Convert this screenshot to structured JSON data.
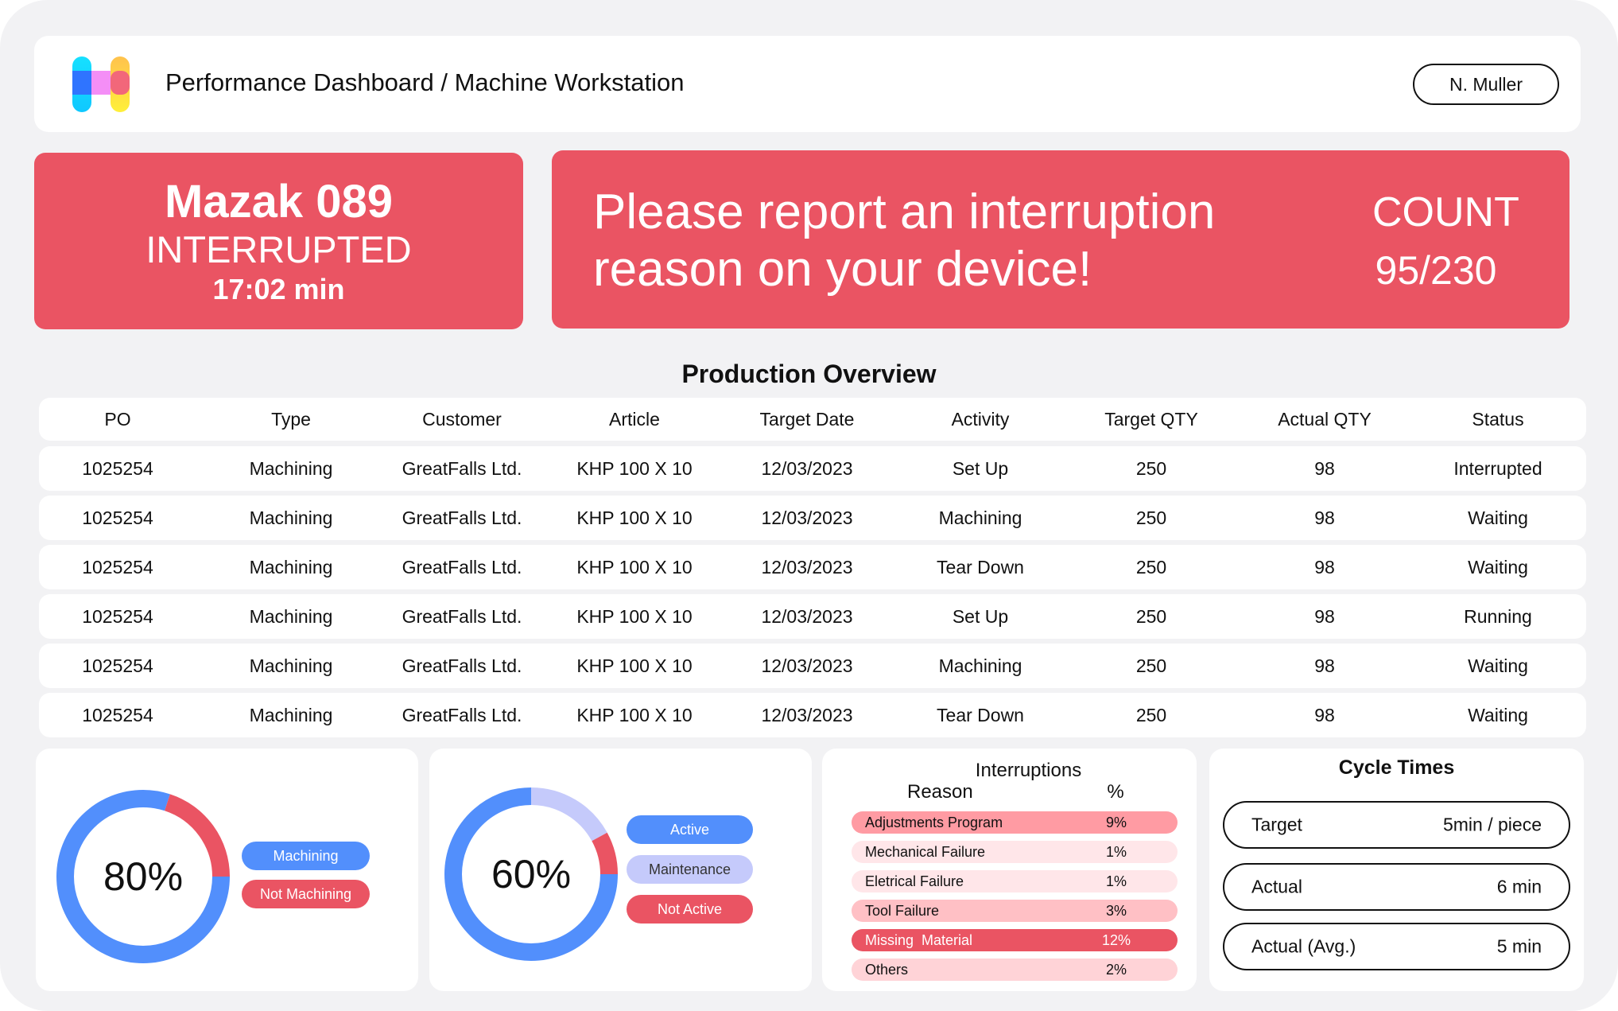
{
  "header": {
    "title": "Performance Dashboard / Machine Workstation",
    "user": "N. Muller",
    "logo": "H-logo"
  },
  "machine": {
    "name": "Mazak 089",
    "state": "INTERRUPTED",
    "duration": "17:02 min"
  },
  "alert": {
    "line1": "Please report an interruption",
    "line2": "reason on your device!",
    "count_label": "COUNT",
    "count_value": "95/230"
  },
  "production": {
    "title": "Production Overview",
    "columns": [
      "PO",
      "Type",
      "Customer",
      "Article",
      "Target Date",
      "Activity",
      "Target QTY",
      "Actual QTY",
      "Status"
    ],
    "rows": [
      [
        "1025254",
        "Machining",
        "GreatFalls Ltd.",
        "KHP 100 X 10",
        "12/03/2023",
        "Set Up",
        "250",
        "98",
        "Interrupted"
      ],
      [
        "1025254",
        "Machining",
        "GreatFalls Ltd.",
        "KHP 100 X 10",
        "12/03/2023",
        "Machining",
        "250",
        "98",
        "Waiting"
      ],
      [
        "1025254",
        "Machining",
        "GreatFalls Ltd.",
        "KHP 100 X 10",
        "12/03/2023",
        "Tear Down",
        "250",
        "98",
        "Waiting"
      ],
      [
        "1025254",
        "Machining",
        "GreatFalls Ltd.",
        "KHP 100 X 10",
        "12/03/2023",
        "Set Up",
        "250",
        "98",
        "Running"
      ],
      [
        "1025254",
        "Machining",
        "GreatFalls Ltd.",
        "KHP 100 X 10",
        "12/03/2023",
        "Machining",
        "250",
        "98",
        "Waiting"
      ],
      [
        "1025254",
        "Machining",
        "GreatFalls Ltd.",
        "KHP 100 X 10",
        "12/03/2023",
        "Tear Down",
        "250",
        "98",
        "Waiting"
      ]
    ]
  },
  "donut1": {
    "label": "80%",
    "segments": [
      {
        "name": "Machining",
        "value": 80,
        "color": "#528ffc"
      },
      {
        "name": "Not Machining",
        "value": 20,
        "color": "#ea5463"
      }
    ],
    "legend": [
      "Machining",
      "Not Machining"
    ]
  },
  "donut2": {
    "label": "60%",
    "segments": [
      {
        "name": "Active",
        "value": 75,
        "color": "#528ffc"
      },
      {
        "name": "Maintenance",
        "value": 17,
        "color": "#c5cafb"
      },
      {
        "name": "Not Active",
        "value": 8,
        "color": "#ea5463"
      }
    ],
    "legend": [
      "Active",
      "Maintenance",
      "Not Active"
    ]
  },
  "interruptions": {
    "title": "Interruptions",
    "col_reason": "Reason",
    "col_pct": "%",
    "rows": [
      {
        "reason": "Adjustments Program",
        "pct": "9%",
        "color": "#ff9ba3"
      },
      {
        "reason": "Mechanical Failure",
        "pct": "1%",
        "color": "#ffe6e9"
      },
      {
        "reason": "Eletrical Failure",
        "pct": "1%",
        "color": "#ffe6e9"
      },
      {
        "reason": "Tool Failure",
        "pct": "3%",
        "color": "#ffc0c5"
      },
      {
        "reason": "Missing  Material",
        "pct": "12%",
        "color": "#ea5463"
      },
      {
        "reason": "Others",
        "pct": "2%",
        "color": "#ffd3d7"
      }
    ]
  },
  "cycle": {
    "title": "Cycle Times",
    "rows": [
      {
        "label": "Target",
        "value": "5min / piece"
      },
      {
        "label": "Actual",
        "value": "6 min"
      },
      {
        "label": "Actual (Avg.)",
        "value": "5 min"
      }
    ]
  }
}
